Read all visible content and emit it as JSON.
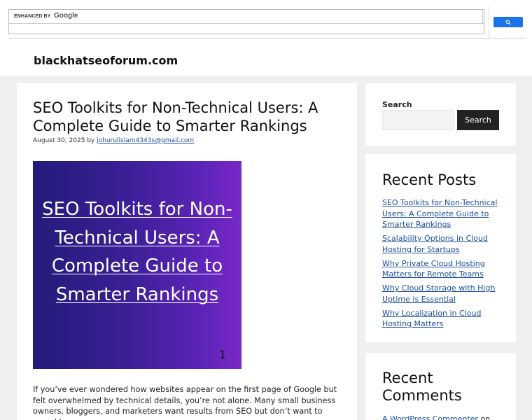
{
  "google_search": {
    "enhanced_label": "ENHANCED BY",
    "brand": "Google",
    "button_icon": "search-icon",
    "accent": "#1a73e8"
  },
  "header": {
    "site_title": "blackhatseoforum.com"
  },
  "post": {
    "title": "SEO Toolkits for Non-Technical Users: A Complete Guide to Smarter Rankings",
    "date": "August 30, 2025",
    "by": "by",
    "author": "johurulislam4343s@gmail.com",
    "featured_text": "SEO Toolkits for Non-Technical Users: A Complete Guide to Smarter Rankings",
    "featured_number": "1",
    "excerpt": "If you’ve ever wondered how websites appear on the first page of Google but felt overwhelmed by technical details, you’re not alone. Many small business owners, bloggers, and marketers want results from SEO but don’t want to spend hours"
  },
  "sidebar": {
    "search_label": "Search",
    "search_button": "Search",
    "recent_posts_title": "Recent Posts",
    "recent_posts": [
      "SEO Toolkits for Non-Technical Users: A Complete Guide to Smarter Rankings",
      "Scalability Options in Cloud Hosting for Startups",
      "Why Private Cloud Hosting Matters for Remote Teams",
      "Why Cloud Storage with High Uptime is Essential",
      "Why Localization in Cloud Hosting Matters"
    ],
    "recent_comments_title": "Recent Comments",
    "comment_author": "A WordPress Commenter",
    "comment_on": "on"
  }
}
